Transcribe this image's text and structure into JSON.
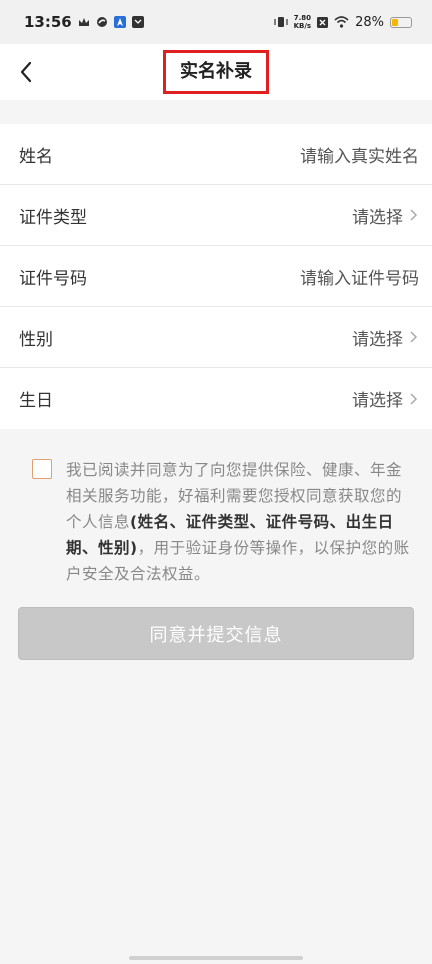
{
  "status_bar": {
    "time": "13:56",
    "net_speed_value": "7.80",
    "net_speed_unit": "KB/s",
    "battery": "28%"
  },
  "nav": {
    "title": "实名补录"
  },
  "form": {
    "rows": [
      {
        "label": "姓名",
        "value": "请输入真实姓名"
      },
      {
        "label": "证件类型",
        "value": "请选择"
      },
      {
        "label": "证件号码",
        "value": "请输入证件号码"
      },
      {
        "label": "性别",
        "value": "请选择"
      },
      {
        "label": "生日",
        "value": "请选择"
      }
    ]
  },
  "agreement": {
    "text_before": "我已阅读并同意为了向您提供保险、健康、年金相关服务功能，好福利需要您授权同意获取您的个人信息",
    "text_bold": "(姓名、证件类型、证件号码、出生日期、性别)",
    "text_after": "，用于验证身份等操作，以保护您的账户安全及合法权益。"
  },
  "submit": {
    "label": "同意并提交信息"
  }
}
